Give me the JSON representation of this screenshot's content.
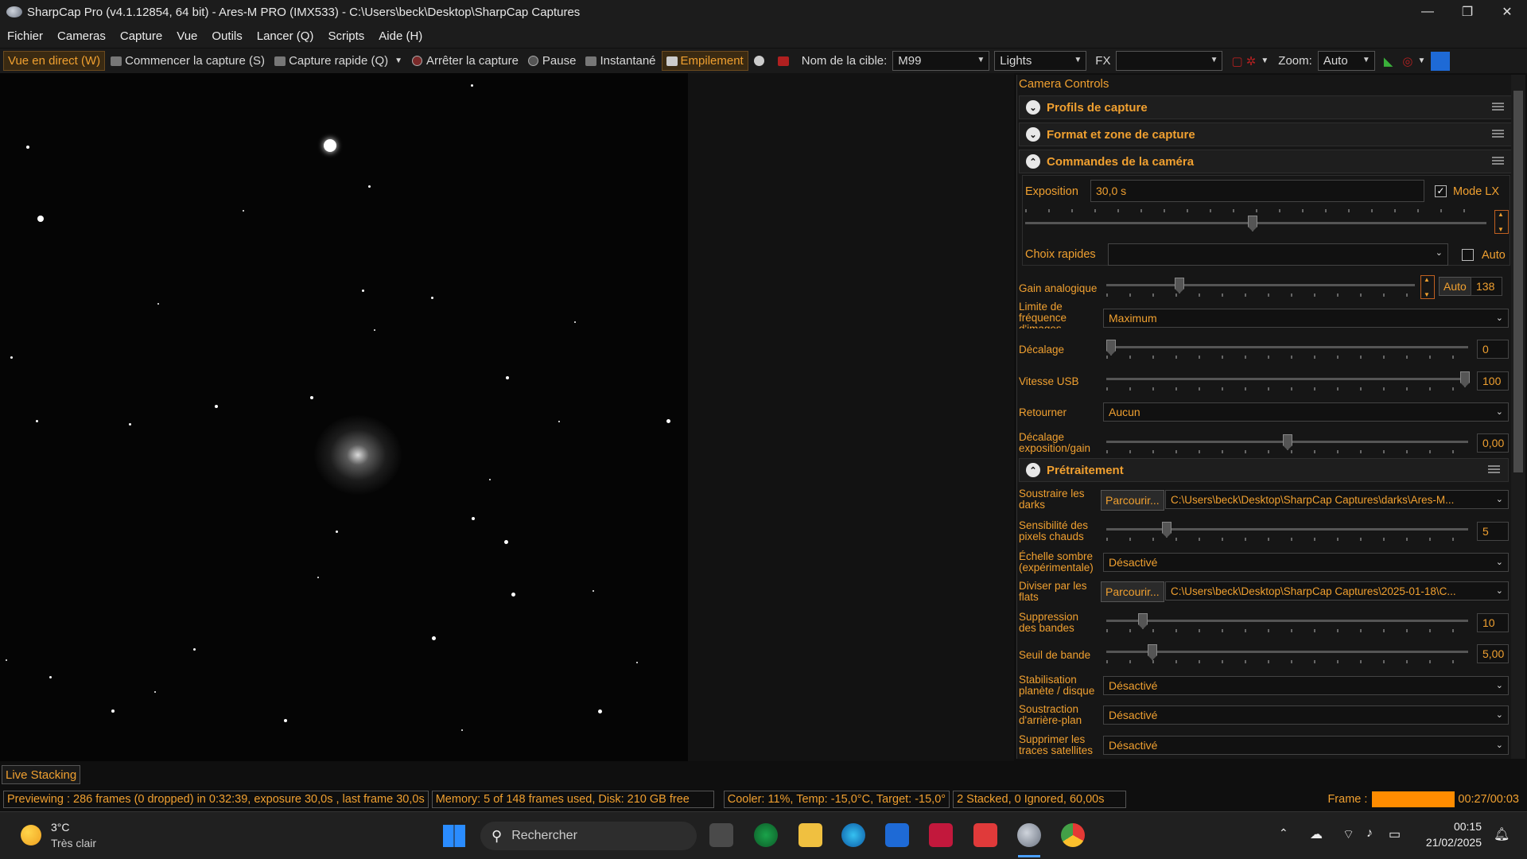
{
  "window": {
    "title": "SharpCap Pro (v4.1.12854, 64 bit) - Ares-M PRO (IMX533) - C:\\Users\\beck\\Desktop\\SharpCap Captures",
    "minimize": "—",
    "maximize": "❐",
    "close": "✕"
  },
  "menu": [
    "Fichier",
    "Cameras",
    "Capture",
    "Vue",
    "Outils",
    "Lancer (Q)",
    "Scripts",
    "Aide (H)"
  ],
  "toolbar": {
    "live_view": "Vue en direct (W)",
    "start_capture": "Commencer la capture (S)",
    "quick_capture": "Capture rapide (Q)",
    "stop_capture": "Arrêter la capture",
    "pause": "Pause",
    "snapshot": "Instantané",
    "stacking": "Empilement",
    "target_label": "Nom de la cible:",
    "target_value": "M99",
    "frame_type": "Lights",
    "fx_label": "FX",
    "fx_value": "",
    "zoom_label": "Zoom:",
    "zoom_value": "Auto"
  },
  "panel": {
    "title": "Camera Controls",
    "sections": {
      "profiles": "Profils de capture",
      "format": "Format et zone de capture",
      "camera": "Commandes de la caméra",
      "preprocess": "Prétraitement"
    },
    "camera": {
      "exposure_label": "Exposition",
      "exposure_value": "30,0 s",
      "lx_label": "Mode LX",
      "lx_checked": true,
      "quick_label": "Choix rapides",
      "quick_value": "",
      "auto_label": "Auto",
      "gain_label": "Gain analogique",
      "gain_auto": "Auto",
      "gain_value": "138",
      "fps_label": "Limite de fréquence d'images",
      "fps_value": "Maximum",
      "offset_label": "Décalage",
      "offset_value": "0",
      "usb_label": "Vitesse USB",
      "usb_value": "100",
      "flip_label": "Retourner",
      "flip_value": "Aucun",
      "expgain_label": "Décalage exposition/gain",
      "expgain_value": "0,00"
    },
    "preprocess": {
      "darks_label": "Soustraire les darks",
      "darks_browse": "Parcourir...",
      "darks_path": "C:\\Users\\beck\\Desktop\\SharpCap Captures\\darks\\Ares-M...",
      "hotpix_label": "Sensibilité des pixels chauds",
      "hotpix_value": "5",
      "darkscale_label": "Échelle sombre (expérimentale)",
      "darkscale_value": "Désactivé",
      "flats_label": "Diviser par les flats",
      "flats_browse": "Parcourir...",
      "flats_path": "C:\\Users\\beck\\Desktop\\SharpCap Captures\\2025-01-18\\C...",
      "banding_label": "Suppression des bandes",
      "banding_value": "10",
      "band_thresh_label": "Seuil de bande",
      "band_thresh_value": "5,00",
      "stab_label": "Stabilisation planète / disque",
      "stab_value": "Désactivé",
      "bg_label": "Soustraction d'arrière-plan",
      "bg_value": "Désactivé",
      "sat_label": "Supprimer les traces satellites",
      "sat_value": "Désactivé"
    }
  },
  "live_stacking_tab": "Live Stacking",
  "status": {
    "preview": "Previewing : 286 frames (0 dropped) in 0:32:39, exposure 30,0s , last frame 30,0s",
    "memory": "Memory: 5 of 148 frames used, Disk: 210 GB free",
    "cooler": "Cooler: 11%, Temp: -15,0°C, Target: -15,0°",
    "stacked": "2 Stacked, 0 Ignored, 60,00s",
    "frame_label": "Frame :",
    "frame_time": "00:27/00:03"
  },
  "taskbar": {
    "temp": "3°C",
    "weather": "Très clair",
    "search": "Rechercher",
    "time": "00:15",
    "date": "21/02/2025"
  },
  "colors": {
    "accent": "#f0a030",
    "frame_bar": "#ff8c00"
  }
}
